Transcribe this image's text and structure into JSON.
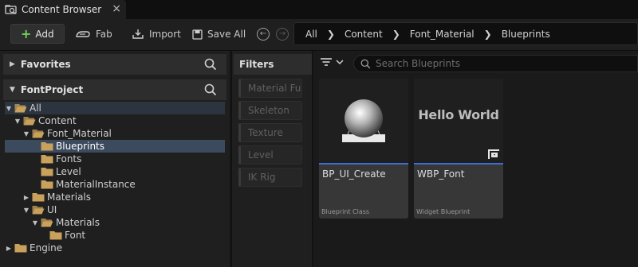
{
  "tab": {
    "title": "Content Browser",
    "icon": "content-browser-icon",
    "close": "×"
  },
  "toolbar": {
    "add_label": "Add",
    "fab_label": "Fab",
    "import_label": "Import",
    "save_all_label": "Save All"
  },
  "breadcrumb": [
    "All",
    "Content",
    "Font_Material",
    "Blueprints"
  ],
  "favorites": {
    "label": "Favorites"
  },
  "project": {
    "label": "FontProject"
  },
  "tree": [
    {
      "label": "All",
      "depth": 0,
      "expanded": true,
      "has_children": true,
      "state": "hl"
    },
    {
      "label": "Content",
      "depth": 1,
      "expanded": true,
      "has_children": true,
      "state": ""
    },
    {
      "label": "Font_Material",
      "depth": 2,
      "expanded": true,
      "has_children": true,
      "state": ""
    },
    {
      "label": "Blueprints",
      "depth": 3,
      "expanded": false,
      "has_children": false,
      "state": "selected"
    },
    {
      "label": "Fonts",
      "depth": 3,
      "expanded": false,
      "has_children": false,
      "state": ""
    },
    {
      "label": "Level",
      "depth": 3,
      "expanded": false,
      "has_children": false,
      "state": ""
    },
    {
      "label": "MaterialInstance",
      "depth": 3,
      "expanded": false,
      "has_children": false,
      "state": ""
    },
    {
      "label": "Materials",
      "depth": 2,
      "expanded": false,
      "has_children": true,
      "state": ""
    },
    {
      "label": "UI",
      "depth": 2,
      "expanded": true,
      "has_children": true,
      "state": ""
    },
    {
      "label": "Materials",
      "depth": 3,
      "expanded": true,
      "has_children": true,
      "state": ""
    },
    {
      "label": "Font",
      "depth": 4,
      "expanded": false,
      "has_children": false,
      "state": ""
    },
    {
      "label": "Engine",
      "depth": 0,
      "expanded": false,
      "has_children": true,
      "state": ""
    }
  ],
  "filters": {
    "header": "Filters",
    "items": [
      "Material Fun",
      "Skeleton",
      "Texture",
      "Level",
      "IK Rig"
    ]
  },
  "search": {
    "placeholder": "Search Blueprints",
    "value": ""
  },
  "assets": [
    {
      "name": "BP_UI_Create",
      "type": "Blueprint Class",
      "thumbnail": "sphere-on-pedestal"
    },
    {
      "name": "WBP_Font",
      "type": "Widget Blueprint",
      "thumbnail": "text",
      "thumbnail_text": "Hello World"
    }
  ],
  "colors": {
    "accent_blue": "#3b6fd6",
    "add_plus": "#6fd35c",
    "folder": "#c9a15c",
    "selected_row": "#3c4a5e"
  }
}
